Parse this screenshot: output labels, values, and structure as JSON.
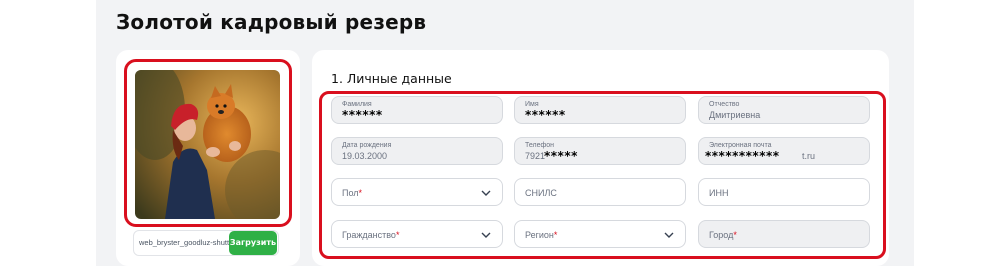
{
  "page": {
    "title": "Золотой кадровый резерв"
  },
  "photo": {
    "file_name": "web_bryster_goodluz-shutto",
    "upload_label": "Загрузить",
    "image_icon": "photo-of-woman-with-dog"
  },
  "section": {
    "title": "1. Личные данные"
  },
  "fields": {
    "last_name": {
      "label": "Фамилия",
      "value": "******"
    },
    "first_name": {
      "label": "Имя",
      "value": "******"
    },
    "patronymic": {
      "label": "Отчество",
      "value": "Дмитриевна"
    },
    "birth_date": {
      "label": "Дата рождения",
      "value": "19.03.2000"
    },
    "phone": {
      "label": "Телефон",
      "prefix": "7921",
      "value": "*****"
    },
    "email": {
      "label": "Электронная почта",
      "value": "***********",
      "suffix": "t.ru"
    },
    "gender": {
      "placeholder": "Пол",
      "required": "*"
    },
    "snils": {
      "placeholder": "СНИЛС"
    },
    "inn": {
      "placeholder": "ИНН"
    },
    "citizenship": {
      "placeholder": "Гражданство",
      "required": "*"
    },
    "region": {
      "placeholder": "Регион",
      "required": "*"
    },
    "city": {
      "placeholder": "Город",
      "required": "*"
    }
  },
  "colors": {
    "highlight": "#d90f1e",
    "upload_button": "#2fb046",
    "page_background": "#f2f3f5"
  }
}
